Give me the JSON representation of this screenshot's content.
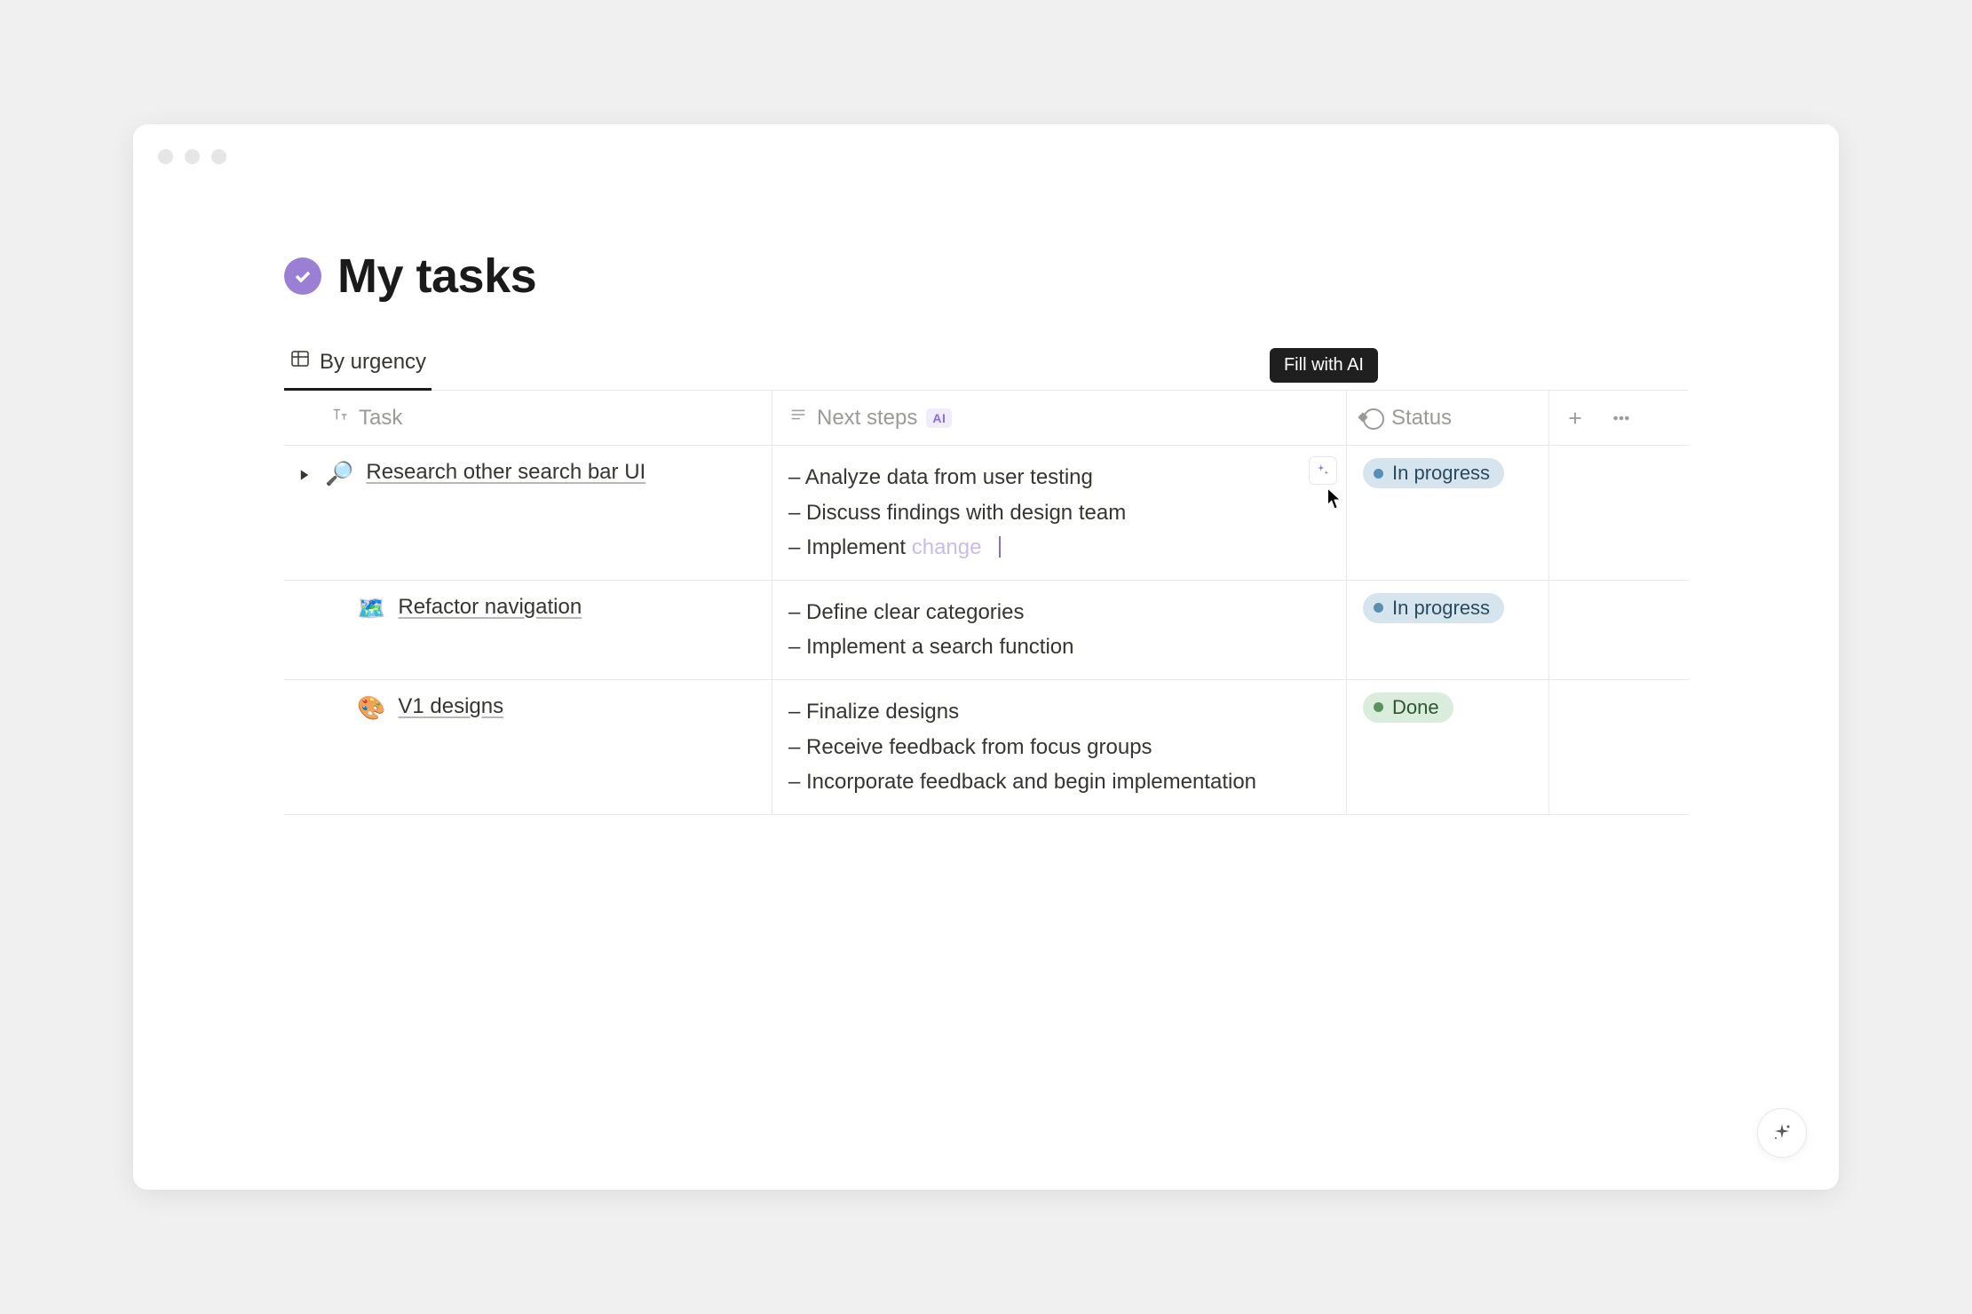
{
  "page": {
    "title": "My tasks"
  },
  "tabs": {
    "active": "By urgency"
  },
  "columns": {
    "task": "Task",
    "next_steps": "Next steps",
    "ai_badge": "AI",
    "status": "Status"
  },
  "tooltip": {
    "fill_with_ai": "Fill with AI"
  },
  "status_labels": {
    "in_progress": "In progress",
    "done": "Done"
  },
  "rows": [
    {
      "emoji": "🔎",
      "title": "Research other search bar UI",
      "expandable": true,
      "steps": [
        "– Analyze data from user testing",
        "– Discuss findings with design team"
      ],
      "typing_prefix": "– Implement ",
      "typing_faded": "change",
      "status": "in_progress",
      "show_ai_btn": true
    },
    {
      "emoji": "🗺️",
      "title": "Refactor navigation",
      "expandable": false,
      "steps": [
        "– Define clear categories",
        "– Implement a search function"
      ],
      "status": "in_progress"
    },
    {
      "emoji": "🎨",
      "title": "V1 designs",
      "expandable": false,
      "steps": [
        "– Finalize designs",
        "– Receive feedback from focus groups",
        "– Incorporate feedback and begin implementation"
      ],
      "status": "done"
    }
  ]
}
